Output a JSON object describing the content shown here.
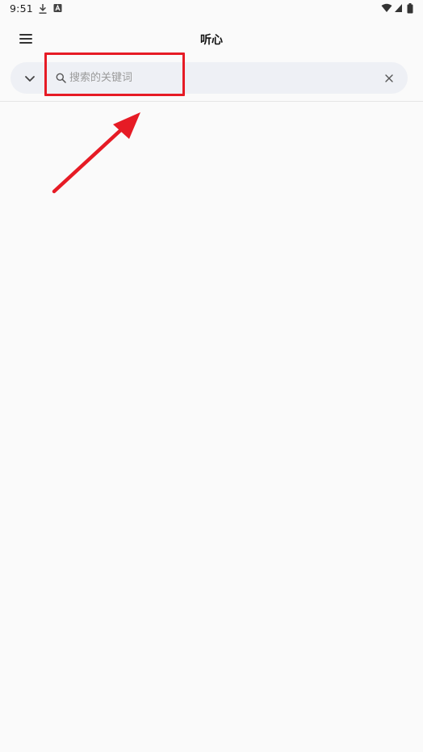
{
  "status_bar": {
    "time": "9:51",
    "left_icons": [
      "download-icon",
      "a-badge-icon"
    ],
    "right_icons": [
      "wifi-icon",
      "signal-icon",
      "battery-icon"
    ]
  },
  "app_bar": {
    "title": "听心",
    "menu_icon": "hamburger-menu-icon"
  },
  "search": {
    "placeholder": "搜索的关键词",
    "value": "",
    "collapse_icon": "chevron-down-icon",
    "search_icon": "search-icon",
    "clear_icon": "close-icon"
  },
  "annotation": {
    "color": "#e61b25"
  },
  "colors": {
    "background": "#fafafa",
    "search_bar_bg": "#eef0f5",
    "annotation": "#e61b25"
  }
}
